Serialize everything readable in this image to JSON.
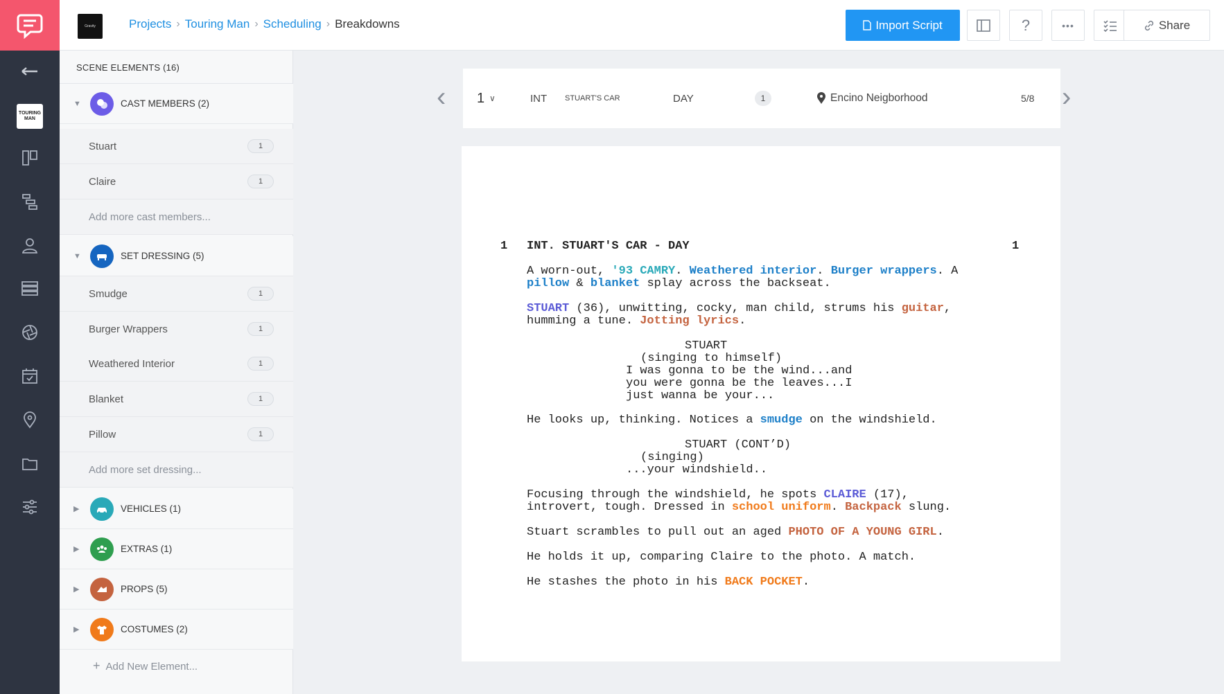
{
  "rail": {
    "project_thumb_text": "TOURING MAN"
  },
  "topbar": {
    "org_logo_text": "Gravity",
    "breadcrumb": [
      "Projects",
      "Touring Man",
      "Scheduling",
      "Breakdowns"
    ],
    "import_label": "Import Script",
    "share_label": "Share"
  },
  "panel": {
    "header": "SCENE ELEMENTS (16)",
    "cast": {
      "label": "CAST MEMBERS (2)",
      "items": [
        {
          "name": "Stuart",
          "count": "1"
        },
        {
          "name": "Claire",
          "count": "1"
        }
      ],
      "add": "Add more cast members..."
    },
    "set": {
      "label": "SET DRESSING (5)",
      "items": [
        {
          "name": "Smudge",
          "count": "1"
        },
        {
          "name": "Burger Wrappers",
          "count": "1"
        },
        {
          "name": "Weathered Interior",
          "count": "1"
        },
        {
          "name": "Blanket",
          "count": "1"
        },
        {
          "name": "Pillow",
          "count": "1"
        }
      ],
      "add": "Add more set dressing..."
    },
    "vehicles": {
      "label": "VEHICLES (1)"
    },
    "extras": {
      "label": "EXTRAS (1)"
    },
    "props": {
      "label": "PROPS (5)"
    },
    "costumes": {
      "label": "COSTUMES (2)"
    },
    "add_new": "Add New Element..."
  },
  "scene": {
    "number": "1",
    "int_ext": "INT",
    "set_name": "STUART'S CAR",
    "time_of_day": "DAY",
    "page": "1",
    "location": "Encino Neigborhood",
    "eighths": "5/8"
  },
  "colors": {
    "brand": "#f4566d",
    "primary": "#2196f3",
    "cast": "#6c5ce7",
    "set_dressing": "#1565c0",
    "vehicles": "#29a9b8",
    "extras": "#2e9e4f",
    "props": "#c4633f",
    "costumes": "#f07a1a"
  },
  "script": {
    "scene_num_left": "1",
    "scene_num_right": "1",
    "heading": "INT. STUART'S CAR - DAY",
    "p1": [
      "A worn-out, ",
      "'93 CAMRY",
      ". ",
      "Weathered interior",
      ". ",
      "Burger wrappers",
      ". A",
      "pillow",
      " & ",
      "blanket",
      " splay across the backseat."
    ],
    "p2": [
      "STUART",
      " (36), unwitting, cocky, man child, strums his ",
      "guitar",
      ",",
      "humming a tune. ",
      "Jotting lyrics",
      "."
    ],
    "char1": "STUART",
    "paren1": "(singing to himself)",
    "dlg1": [
      "I was gonna to be the wind...and",
      "you were gonna be the leaves...I",
      "just wanna be your..."
    ],
    "p3": [
      "He looks up, thinking. Notices a ",
      "smudge",
      " on the windshield."
    ],
    "char2": "STUART (CONT’D)",
    "paren2": "(singing)",
    "dlg2": "...your windshield..",
    "p4": [
      "Focusing through the windshield, he spots ",
      "CLAIRE",
      " (17),",
      "introvert, tough. Dressed in ",
      "school uniform",
      ". ",
      "Backpack",
      " slung."
    ],
    "p5": [
      "Stuart scrambles to pull out an aged ",
      "PHOTO OF A YOUNG GIRL",
      "."
    ],
    "p6": "He holds it up, comparing Claire to the photo. A match.",
    "p7": [
      "He stashes the photo in his ",
      "BACK POCKET",
      "."
    ]
  }
}
